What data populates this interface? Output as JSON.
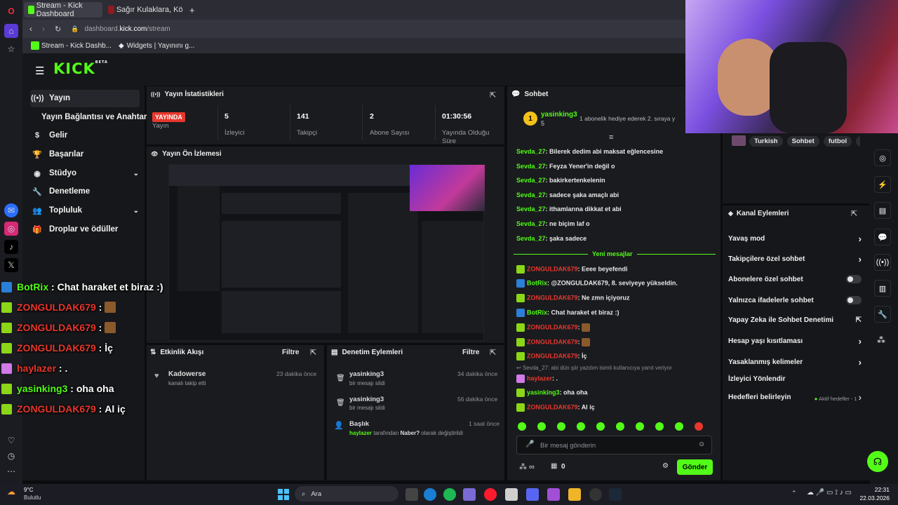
{
  "browser": {
    "tabs": [
      {
        "label": "Stream - Kick Dashboard"
      },
      {
        "label": "Sağır Kulaklara, Kör gözle"
      }
    ],
    "url_prefix": "dashboard.",
    "url_domain": "kick.com",
    "url_path": "/stream",
    "bookmarks": [
      {
        "label": "Stream - Kick Dashb..."
      },
      {
        "label": "Widgets | Yayınını g..."
      }
    ]
  },
  "kick": {
    "logo": "KICK",
    "logo_beta": "BETA",
    "nav": [
      {
        "label": "Yayın",
        "icon": "broadcast-icon"
      },
      {
        "label": "Yayın Bağlantısı ve Anahtarı"
      },
      {
        "label": "Gelir",
        "icon": "dollar-icon"
      },
      {
        "label": "Başarılar",
        "icon": "trophy-icon"
      },
      {
        "label": "Stüdyo",
        "icon": "palette-icon"
      },
      {
        "label": "Denetleme",
        "icon": "wrench-icon"
      },
      {
        "label": "Topluluk",
        "icon": "users-icon"
      },
      {
        "label": "Droplar ve ödüller",
        "icon": "gift-icon"
      }
    ]
  },
  "stats": {
    "title": "Yayın İstatistikleri",
    "live_badge": "YAYINDA",
    "items": [
      {
        "value": "",
        "label": "Yayın"
      },
      {
        "value": "5",
        "label": "İzleyici"
      },
      {
        "value": "141",
        "label": "Takipçi"
      },
      {
        "value": "2",
        "label": "Abone Sayısı"
      },
      {
        "value": "01:30:56",
        "label": "Yayında Olduğu Süre"
      }
    ]
  },
  "preview": {
    "title": "Yayın Ön İzlemesi"
  },
  "activity": {
    "title": "Etkinlik Akışı",
    "filter": "Filtre",
    "items": [
      {
        "name": "Kadowerse",
        "text": "kanalı takip etti",
        "time": "23 dakika önce"
      }
    ]
  },
  "mod_actions": {
    "title": "Denetim Eylemleri",
    "filter": "Filtre",
    "items": [
      {
        "name": "yasinking3",
        "text": "bir mesajı sildi",
        "time": "34 dakika önce"
      },
      {
        "name": "yasinking3",
        "text": "bir mesajı sildi",
        "time": "56 dakika önce"
      },
      {
        "name": "Başlık",
        "user": "haylazer",
        "mid": " tarafından ",
        "bold": "Naber?",
        "tail": " olarak değiştirildi",
        "time": "1 saat önce"
      }
    ]
  },
  "chat": {
    "title": "Sohbet",
    "pinned_user": "yasinking3",
    "pinned_count": "5",
    "pinned_text": "1 abonelik hediye ederek 2. sıraya y",
    "old_messages": [
      {
        "user": "Sevda_27",
        "text": "Bilerek dedim abi maksat eğlencesine"
      },
      {
        "user": "Sevda_27",
        "text": "Feyza Yener'in değil o"
      },
      {
        "user": "Sevda_27",
        "text": "bakirkertenkelenin"
      },
      {
        "user": "Sevda_27",
        "text": "sadece şaka amaçlı abi"
      },
      {
        "user": "Sevda_27",
        "text": "ithamlarına dikkat et abi"
      },
      {
        "user": "Sevda_27",
        "text": "ne biçim laf o"
      },
      {
        "user": "Sevda_27",
        "text": "şaka sadece"
      }
    ],
    "new_divider": "Yeni mesajlar",
    "new_messages": [
      {
        "user": "ZONGULDAK679",
        "text": "Eeee beyefendi",
        "color": "#e8372c"
      },
      {
        "user": "BotRix",
        "text": "@ZONGULDAK679, 8. seviyeye yükseldin.",
        "color": "#53fc18"
      },
      {
        "user": "ZONGULDAK679",
        "text": "Ne zmn içiyoruz",
        "color": "#e8372c"
      },
      {
        "user": "BotRix",
        "text": "Chat haraket et biraz :)",
        "color": "#53fc18"
      },
      {
        "user": "ZONGULDAK679",
        "text": "",
        "color": "#e8372c"
      },
      {
        "user": "ZONGULDAK679",
        "text": "",
        "color": "#e8372c"
      },
      {
        "user": "ZONGULDAK679",
        "text": "İç",
        "color": "#e8372c"
      },
      {
        "user": "haylazer",
        "text": ".",
        "color": "#e8372c"
      },
      {
        "user": "yasinking3",
        "text": "oha oha",
        "color": "#53fc18"
      },
      {
        "user": "ZONGULDAK679",
        "text": "Al iç",
        "color": "#e8372c"
      }
    ],
    "reply_ref": "Sevda_27: abi dün şiir yazdım isimli kullanıcıya yanıt veriyor",
    "input_placeholder": "Bir mesaj gönderin",
    "points": "0",
    "send": "Gönder"
  },
  "tags": [
    "Turkish",
    "Sohbet",
    "futbol",
    "jus"
  ],
  "channel_actions": {
    "title": "Kanal Eylemleri",
    "items": [
      {
        "label": "Yavaş mod",
        "kind": "arrow"
      },
      {
        "label": "Takipçilere özel sohbet",
        "kind": "arrow"
      },
      {
        "label": "Abonelere özel sohbet",
        "kind": "toggle"
      },
      {
        "label": "Yalnızca ifadelerle sohbet",
        "kind": "toggle"
      },
      {
        "label": "Yapay Zeka ile Sohbet Denetimi",
        "kind": "external"
      },
      {
        "label": "Hesap yaşı kısıtlaması",
        "kind": "arrow"
      },
      {
        "label": "Yasaklanmış kelimeler",
        "kind": "arrow"
      },
      {
        "label": "İzleyici Yönlendir",
        "kind": "none"
      },
      {
        "label": "Hedefleri belirleyin",
        "kind": "goal",
        "extra": "Aktif hedefler - 1"
      }
    ]
  },
  "overlay": [
    {
      "user": "BotRix",
      "sep": " : ",
      "text": "Chat haraket et biraz :)",
      "color": "#53fc18"
    },
    {
      "user": "ZONGULDAK679",
      "sep": " : ",
      "text": "",
      "color": "#e8372c"
    },
    {
      "user": "ZONGULDAK679",
      "sep": " : ",
      "text": "",
      "color": "#e8372c"
    },
    {
      "user": "ZONGULDAK679",
      "sep": " : ",
      "text": "İç",
      "color": "#e8372c"
    },
    {
      "user": "haylazer",
      "sep": " : ",
      "text": ".",
      "color": "#e8372c"
    },
    {
      "user": "yasinking3",
      "sep": " : ",
      "text": "oha oha",
      "color": "#53fc18"
    },
    {
      "user": "ZONGULDAK679",
      "sep": " : ",
      "text": "Al iç",
      "color": "#e8372c"
    }
  ],
  "taskbar": {
    "temp": "9°C",
    "weather": "Bulutlu",
    "search": "Ara",
    "time": "22:31",
    "date": "22.03.2026"
  }
}
